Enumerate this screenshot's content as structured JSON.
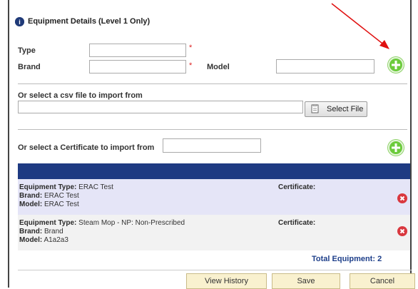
{
  "dialog": {
    "title": "Equipment Details (Level 1 Only)"
  },
  "form": {
    "type_label": "Type",
    "brand_label": "Brand",
    "model_label": "Model",
    "type_value": "",
    "brand_value": "",
    "model_value": "",
    "required_mark": "*"
  },
  "csv": {
    "label": "Or select a csv file to import from",
    "file_value": "",
    "button_label": "Select File"
  },
  "certificate": {
    "label": "Or select a Certificate to import from",
    "value": ""
  },
  "equipment_list": {
    "items": [
      {
        "type_label": "Equipment Type:",
        "type_value": "ERAC Test",
        "brand_label": "Brand:",
        "brand_value": "ERAC Test",
        "model_label": "Model:",
        "model_value": "ERAC Test",
        "certificate_label": "Certificate:"
      },
      {
        "type_label": "Equipment Type:",
        "type_value": "Steam Mop - NP: Non-Prescribed",
        "brand_label": "Brand:",
        "brand_value": "Brand",
        "model_label": "Model:",
        "model_value": "A1a2a3",
        "certificate_label": "Certificate:"
      }
    ],
    "total_text": "Total Equipment: 2"
  },
  "footer": {
    "view_history": "View History",
    "save": "Save",
    "cancel": "Cancel"
  },
  "icons": {
    "title": "info-circle-icon",
    "add": "plus-circle-icon",
    "delete": "x-circle-icon",
    "file": "file-icon",
    "annotation": "arrow-icon"
  },
  "colors": {
    "header_band": "#1e3a82",
    "add_button": "#6ccb3c",
    "delete_button": "#d9383f",
    "total_text": "#1e3f8a",
    "footer_button": "#f9f1cf",
    "annotation_arrow": "#e01010"
  }
}
